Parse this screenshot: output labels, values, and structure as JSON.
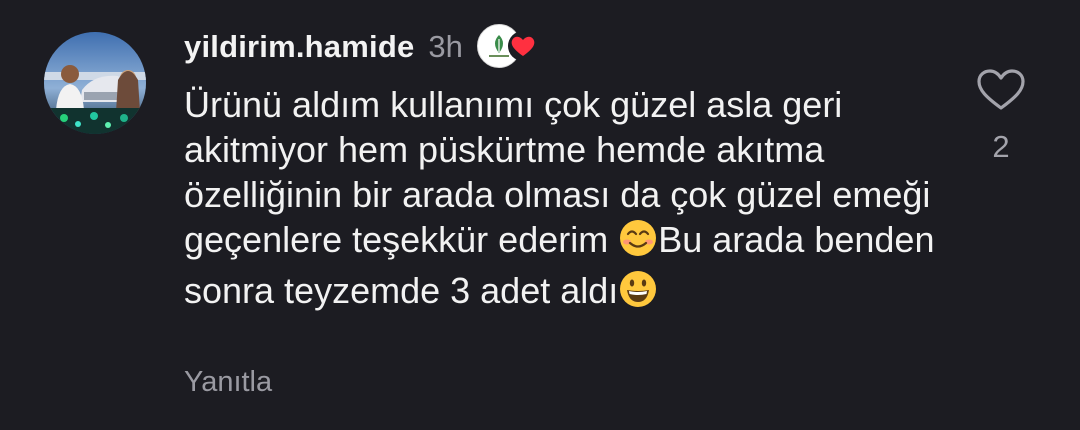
{
  "comment": {
    "username": "yildirim.hamide",
    "time": "3h",
    "text_part1": "Ürünü aldım kullanımı çok güzel asla geri akitmiyor hem püskürtme hemde akıtma özelliğinin bir arada olması da çok güzel emeği geçenlere teşekkür ederim ",
    "emoji1": "smiling-face-with-smiling-eyes",
    "text_part2": "Bu arada benden sonra teyzemde 3 adet aldı",
    "emoji2": "grinning-face",
    "reply_label": "Yanıtla",
    "like_count": "2",
    "liked_by_creator": true
  },
  "icons": {
    "like": "heart-outline-icon",
    "creator_like": "red-heart-icon"
  },
  "colors": {
    "background": "#1c1c22",
    "text_primary": "#f2f2f2",
    "text_secondary": "#9a9aa2",
    "heart_red": "#ff3040",
    "emoji_yellow": "#ffc83d"
  }
}
